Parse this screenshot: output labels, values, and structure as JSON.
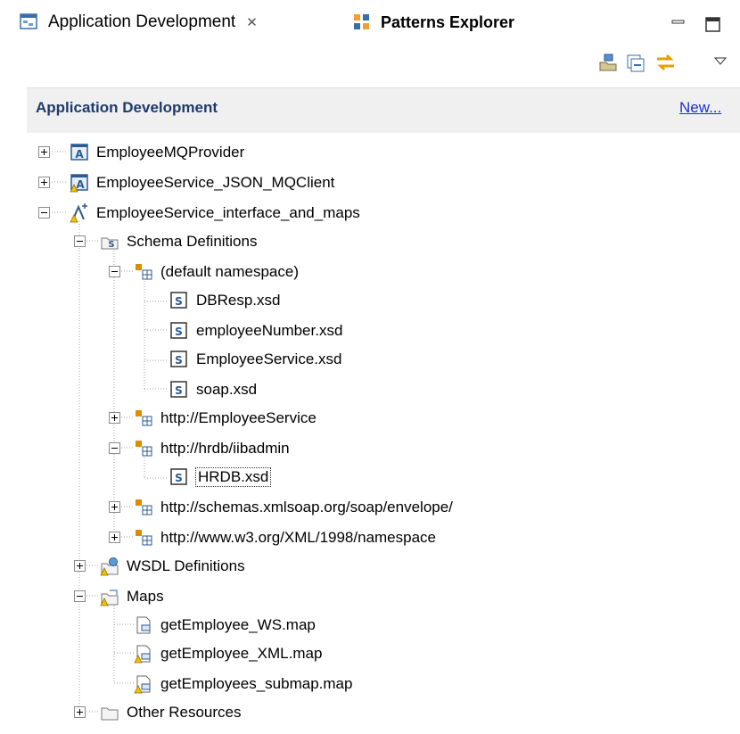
{
  "tabs": {
    "active_label": "Application Development",
    "inactive_label": "Patterns Explorer"
  },
  "section": {
    "title": "Application Development",
    "new_link": "New..."
  },
  "tree": {
    "projects": [
      {
        "label": "EmployeeMQProvider"
      },
      {
        "label": "EmployeeService_JSON_MQClient"
      },
      {
        "label": "EmployeeService_interface_and_maps"
      }
    ],
    "schema_definitions": "Schema Definitions",
    "default_namespace": "(default namespace)",
    "default_files": [
      "DBResp.xsd",
      "employeeNumber.xsd",
      "EmployeeService.xsd",
      "soap.xsd"
    ],
    "ns_employee_service": "http://EmployeeService",
    "ns_hrdb": "http://hrdb/iibadmin",
    "hrdb_file": "HRDB.xsd",
    "ns_soap_envelope": "http://schemas.xmlsoap.org/soap/envelope/",
    "ns_w3_xml": "http://www.w3.org/XML/1998/namespace",
    "wsdl_definitions": "WSDL Definitions",
    "maps": "Maps",
    "map_files": [
      "getEmployee_WS.map",
      "getEmployee_XML.map",
      "getEmployees_submap.map"
    ],
    "other_resources": "Other Resources"
  }
}
